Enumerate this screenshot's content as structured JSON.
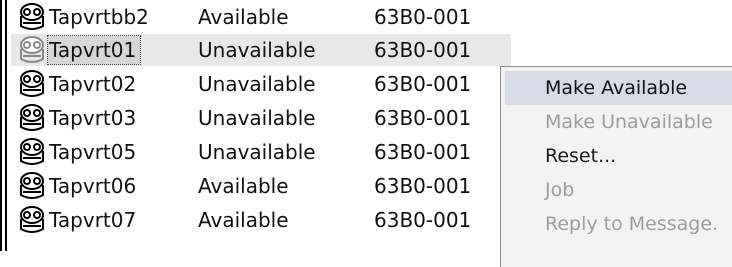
{
  "colors": {
    "selected_row_bg": "#d6d6d6",
    "menu_bg": "#f3f3f3",
    "menu_highlight": "#d7dce6",
    "disabled_text": "#9d9d9d"
  },
  "rows": [
    {
      "icon": "tape-device-icon",
      "name": "Tapvrtbb2",
      "status": "Available",
      "code": "63B0-001"
    },
    {
      "icon": "tape-device-icon",
      "name": "Tapvrt01",
      "status": "Unavailable",
      "code": "63B0-001",
      "selected": true
    },
    {
      "icon": "tape-device-icon",
      "name": "Tapvrt02",
      "status": "Unavailable",
      "code": "63B0-001"
    },
    {
      "icon": "tape-device-icon",
      "name": "Tapvrt03",
      "status": "Unavailable",
      "code": "63B0-001"
    },
    {
      "icon": "tape-device-icon",
      "name": "Tapvrt05",
      "status": "Unavailable",
      "code": "63B0-001"
    },
    {
      "icon": "tape-device-icon",
      "name": "Tapvrt06",
      "status": "Available",
      "code": "63B0-001"
    },
    {
      "icon": "tape-device-icon",
      "name": "Tapvrt07",
      "status": "Available",
      "code": "63B0-001"
    }
  ],
  "context_menu": {
    "items": [
      {
        "label": "Make Available",
        "state": "highlighted"
      },
      {
        "label": "Make Unavailable",
        "state": "disabled"
      },
      {
        "label": "Reset...",
        "state": "enabled"
      },
      {
        "label": "Job",
        "state": "disabled"
      },
      {
        "label": "Reply to Message.",
        "state": "disabled"
      }
    ]
  }
}
